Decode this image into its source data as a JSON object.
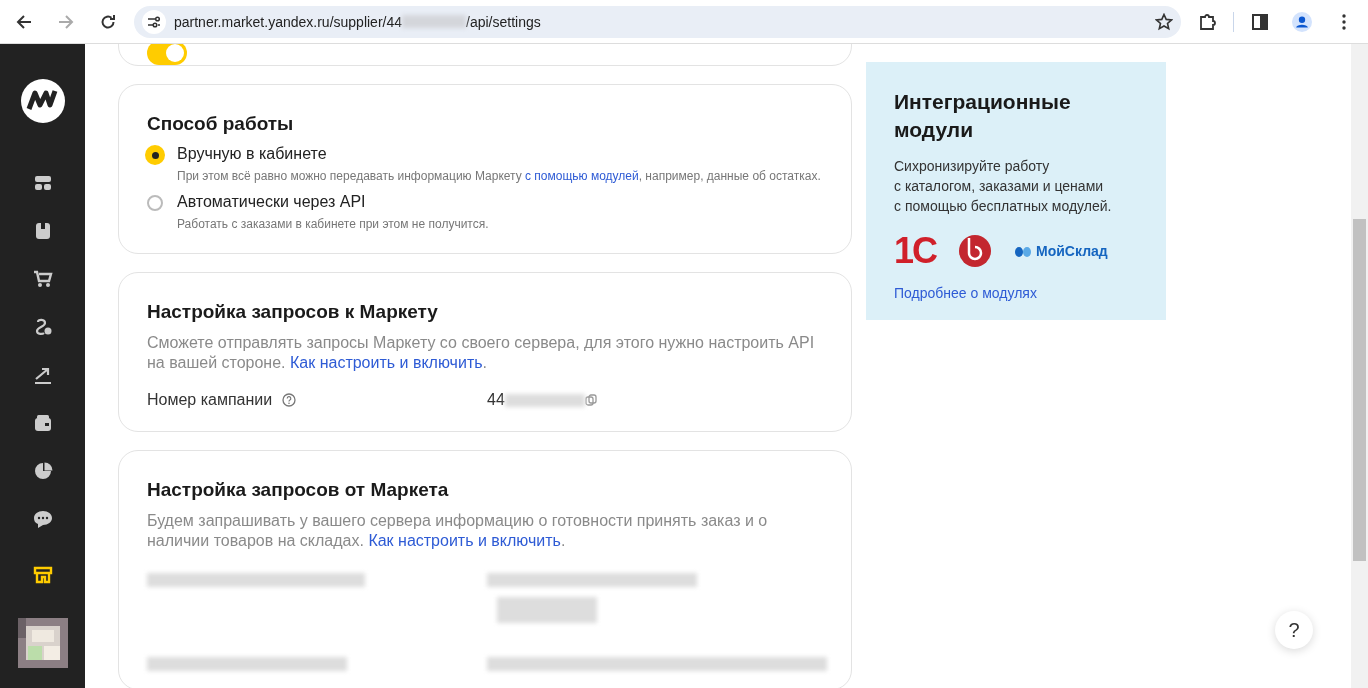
{
  "browser": {
    "url_start": "partner.market.yandex.ru/supplier/44",
    "url_end": "/api/settings",
    "forward_disabled": true
  },
  "sidebar": {
    "items": [
      {
        "selected": false
      },
      {
        "selected": false
      },
      {
        "selected": false
      },
      {
        "selected": false
      },
      {
        "selected": false
      },
      {
        "selected": false
      },
      {
        "selected": false
      },
      {
        "selected": false
      },
      {
        "selected": true
      }
    ]
  },
  "top_card": {
    "toggle_on": true
  },
  "work_mode": {
    "title": "Способ работы",
    "options": [
      {
        "label": "Вручную в кабинете",
        "hint_before": "При этом всё равно можно передавать информацию Маркету ",
        "hint_link": "с помощью модулей",
        "hint_after": ", например, данные об остатках.",
        "selected": true
      },
      {
        "label": "Автоматически через API",
        "hint_before": "Работать с заказами в кабинете при этом не получится.",
        "selected": false
      }
    ]
  },
  "requests_to": {
    "title": "Настройка запросов к Маркету",
    "text": "Сможете отправлять запросы Маркету со своего сервера, для этого нужно настроить API на вашей стороне. ",
    "link": "Как настроить и включить",
    "after": ".",
    "field_label": "Номер кампании",
    "field_value": "44"
  },
  "requests_from": {
    "title": "Настройка запросов от Маркета",
    "text": "Будем запрашивать у вашего сервера информацию о готовности принять заказ и о наличии товаров на складах. ",
    "link": "Как настроить и включить",
    "after": "."
  },
  "promo": {
    "title": "Интеграционные модули",
    "text": "Сихронизируйте работу\nс каталогом, заказами и ценами\nс помощью бесплатных модулей.",
    "logos": [
      {
        "kind": "onec",
        "text": "1С"
      },
      {
        "kind": "ring"
      },
      {
        "kind": "moysklad",
        "text": "МойСклад"
      }
    ],
    "link": "Подробнее о модулях"
  },
  "help_button": "?"
}
